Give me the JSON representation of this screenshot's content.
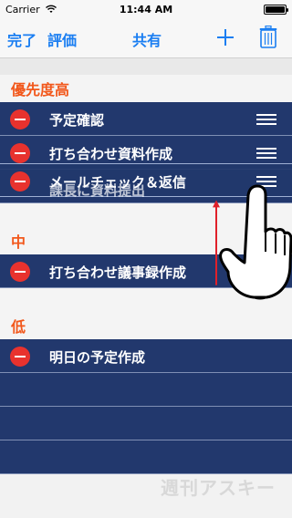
{
  "status": {
    "carrier": "Carrier",
    "time": "11:44 AM"
  },
  "nav": {
    "done": "完了",
    "rate": "評価",
    "share": "共有",
    "add_icon": "plus-icon",
    "trash_icon": "trash-icon"
  },
  "sections": [
    {
      "title": "優先度高",
      "rows": [
        "予定確認",
        "打ち合わせ資料作成"
      ]
    },
    {
      "title": "中",
      "rows": [
        "打ち合わせ議事録作成"
      ]
    },
    {
      "title": "低",
      "rows": [
        "明日の予定作成"
      ]
    }
  ],
  "drag": {
    "dragged_label": "メールチェック＆返信",
    "under_label": "課長に資料提出"
  },
  "watermark": "週刊アスキー",
  "colors": {
    "accent": "#1a7ef2",
    "section_title": "#f2581c",
    "row_bg": "#22386d",
    "delete": "#e8322e"
  }
}
